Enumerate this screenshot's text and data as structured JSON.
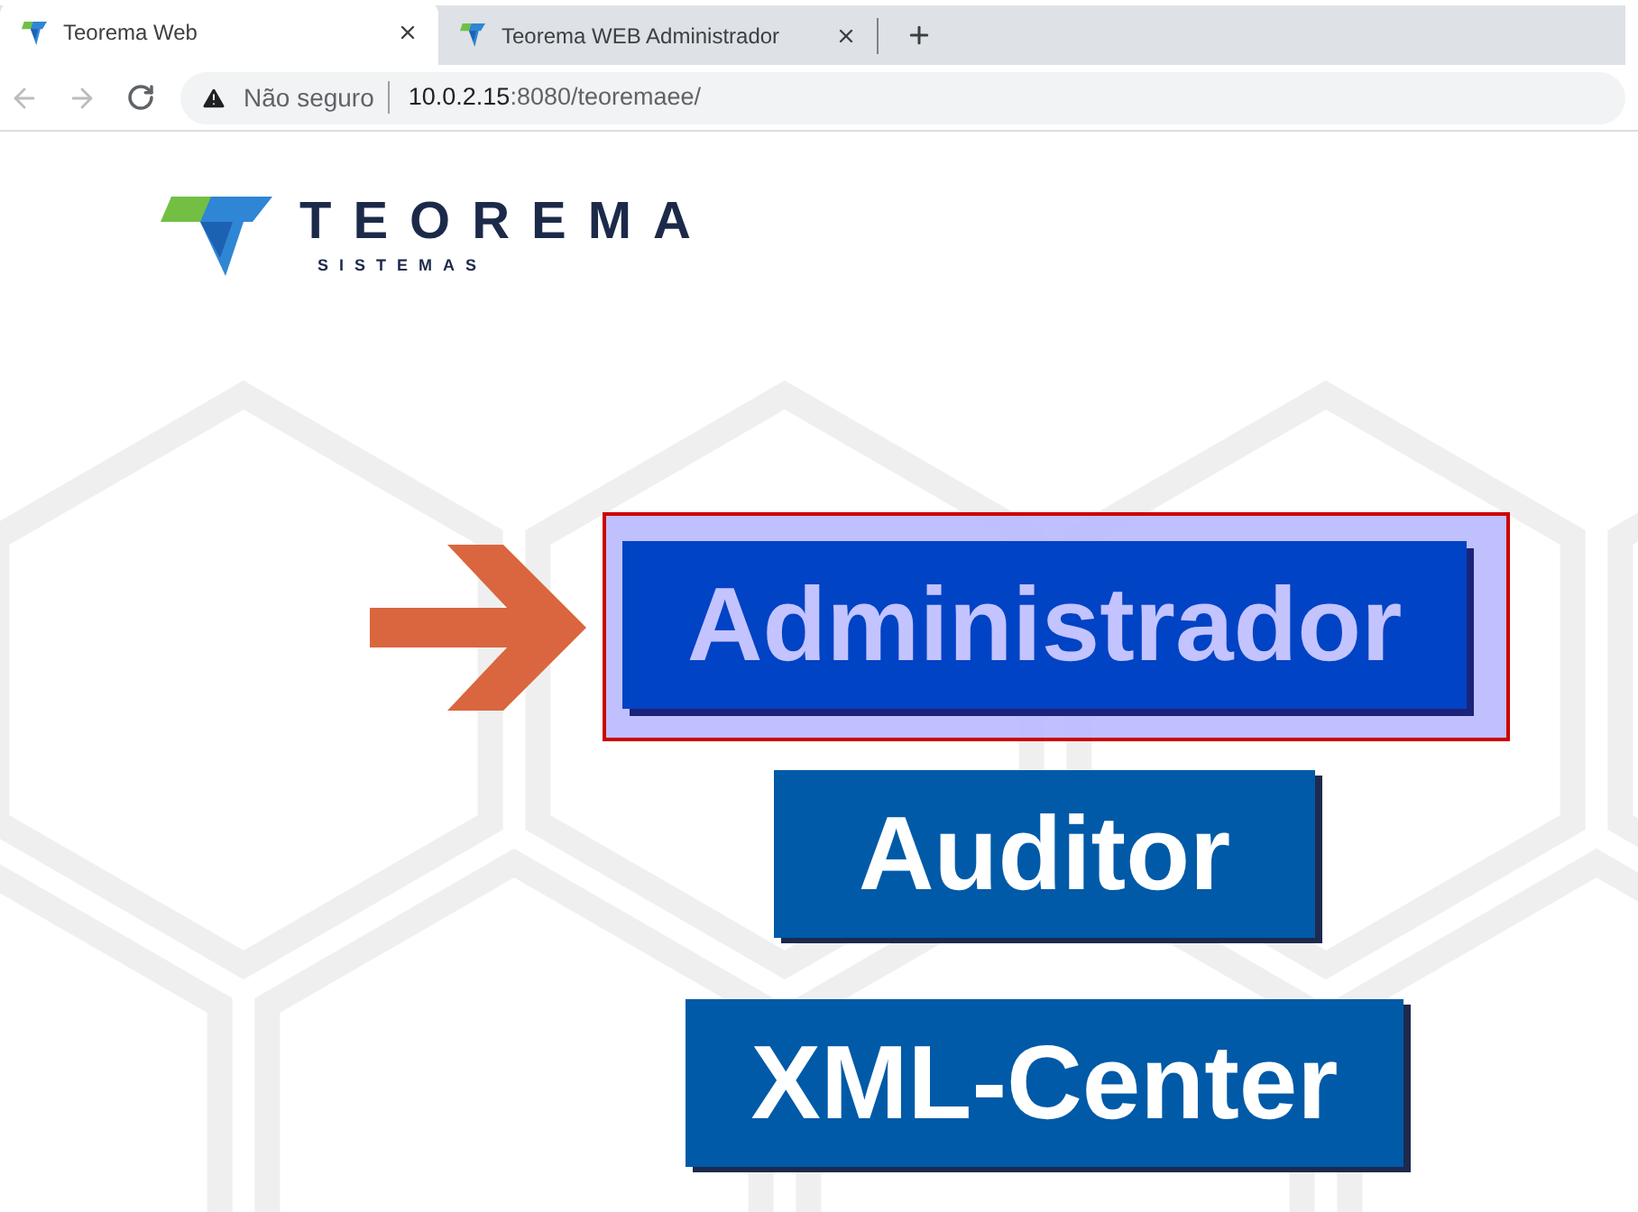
{
  "browser": {
    "tabs": [
      {
        "title": "Teorema Web",
        "selected": true
      },
      {
        "title": "Teorema WEB Administrador",
        "selected": false
      }
    ],
    "toolbar": {
      "back": {
        "disabled": true
      },
      "forward": {
        "disabled": true
      }
    },
    "address_bar": {
      "security_label": "Não seguro",
      "host": "10.0.2.15",
      "path": ":8080/teoremaee/"
    }
  },
  "page": {
    "logo": {
      "name": "TEOREMA",
      "tagline": "SISTEMAS"
    },
    "buttons": [
      {
        "label": "Administrador",
        "selected": true
      },
      {
        "label": "Auditor",
        "selected": false
      },
      {
        "label": "XML-Center",
        "selected": false
      }
    ]
  }
}
